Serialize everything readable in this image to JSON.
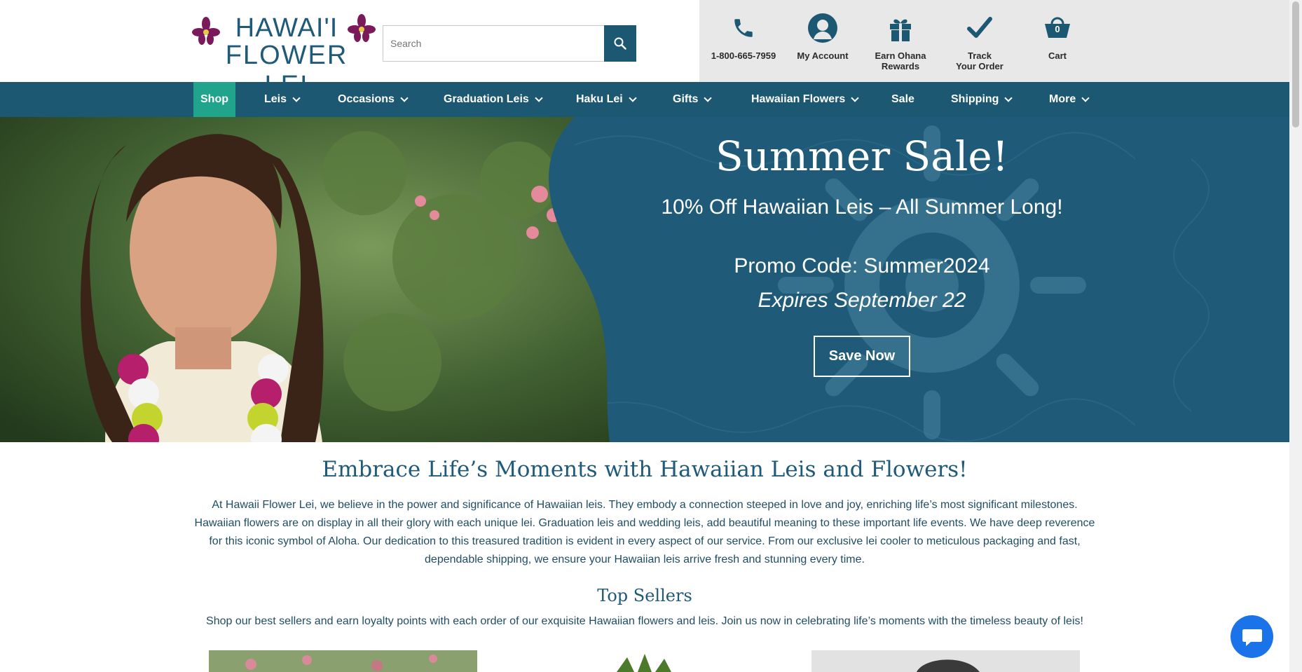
{
  "brand": {
    "logo_line1": "HAWAI'I",
    "logo_line2": "FLOWER LEI",
    "primary_color": "#1d5873",
    "accent_color": "#20a48c"
  },
  "search": {
    "placeholder": "Search"
  },
  "header_links": [
    {
      "label": "1-800-665-7959",
      "icon": "phone-icon"
    },
    {
      "label": "My Account",
      "icon": "account-icon"
    },
    {
      "label_line1": "Earn Ohana",
      "label_line2": "Rewards",
      "icon": "gift-icon"
    },
    {
      "label_line1": "Track",
      "label_line2": "Your Order",
      "icon": "checkmark-icon"
    },
    {
      "label": "Cart",
      "icon": "cart-icon",
      "count": "0"
    }
  ],
  "nav": [
    "Shop",
    "Leis",
    "Occasions",
    "Graduation Leis",
    "Haku Lei",
    "Gifts",
    "Hawaiian Flowers",
    "Sale",
    "Shipping",
    "More"
  ],
  "hero": {
    "title": "Summer Sale!",
    "subtitle": "10% Off Hawaiian Leis – All Summer Long!",
    "promo": "Promo Code: Summer2024",
    "expires": "Expires September 22",
    "button": "Save Now"
  },
  "intro": {
    "heading": "Embrace Life’s Moments with Hawaiian Leis and Flowers!",
    "body": "At Hawaii Flower Lei, we believe in the power and significance of Hawaiian leis. They embody a connection steeped in love and joy, enriching life’s most significant milestones. Hawaiian flowers are on display in all their glory with each unique lei. Graduation leis and wedding leis, add beautiful meaning to these important life events. We have deep reverence for this iconic symbol of Aloha. Our dedication to this treasured tradition is evident in every aspect of our service. From our exclusive lei cooler to meticulous packaging and fast, dependable shipping, we ensure your Hawaiian leis arrive fresh and stunning every time."
  },
  "top_sellers": {
    "heading": "Top Sellers",
    "subtext": "Shop our best sellers and earn loyalty points with each order of our exquisite Hawaiian flowers and leis. Join us now in celebrating life’s moments with the timeless beauty of leis!"
  }
}
